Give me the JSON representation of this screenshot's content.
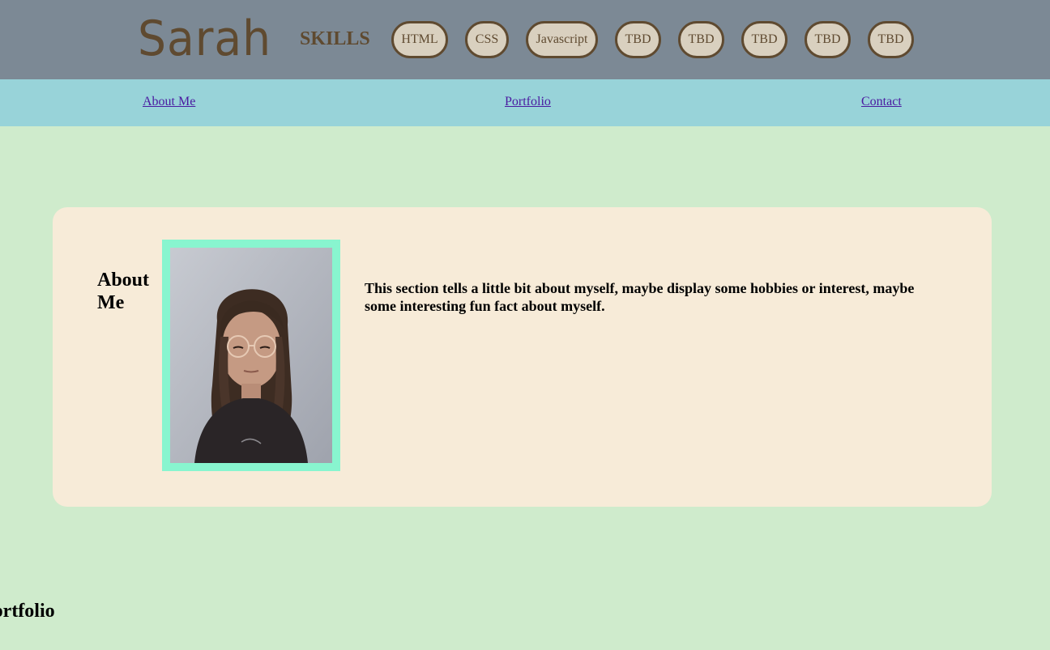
{
  "header": {
    "brand": "Sarah",
    "skills_title": "SKILLS",
    "skills": [
      "HTML",
      "CSS",
      "Javascript",
      "TBD",
      "TBD",
      "TBD",
      "TBD",
      "TBD"
    ]
  },
  "nav": {
    "links": [
      "About Me",
      "Portfolio",
      "Contact"
    ]
  },
  "about": {
    "heading": "About Me",
    "photo_icon": "profile-photo",
    "text": "This section tells a little bit about myself, maybe display some hobbies or interest, maybe some interesting fun fact about myself."
  },
  "portfolio": {
    "heading": "Portfolio"
  },
  "colors": {
    "header_bg": "#7c8995",
    "nav_bg": "#98d3d9",
    "page_bg": "#cfebcc",
    "card_bg": "#f7ebd8",
    "brand": "#5f4a30",
    "photo_border": "#88f5cf",
    "link": "#4a1aa0"
  }
}
